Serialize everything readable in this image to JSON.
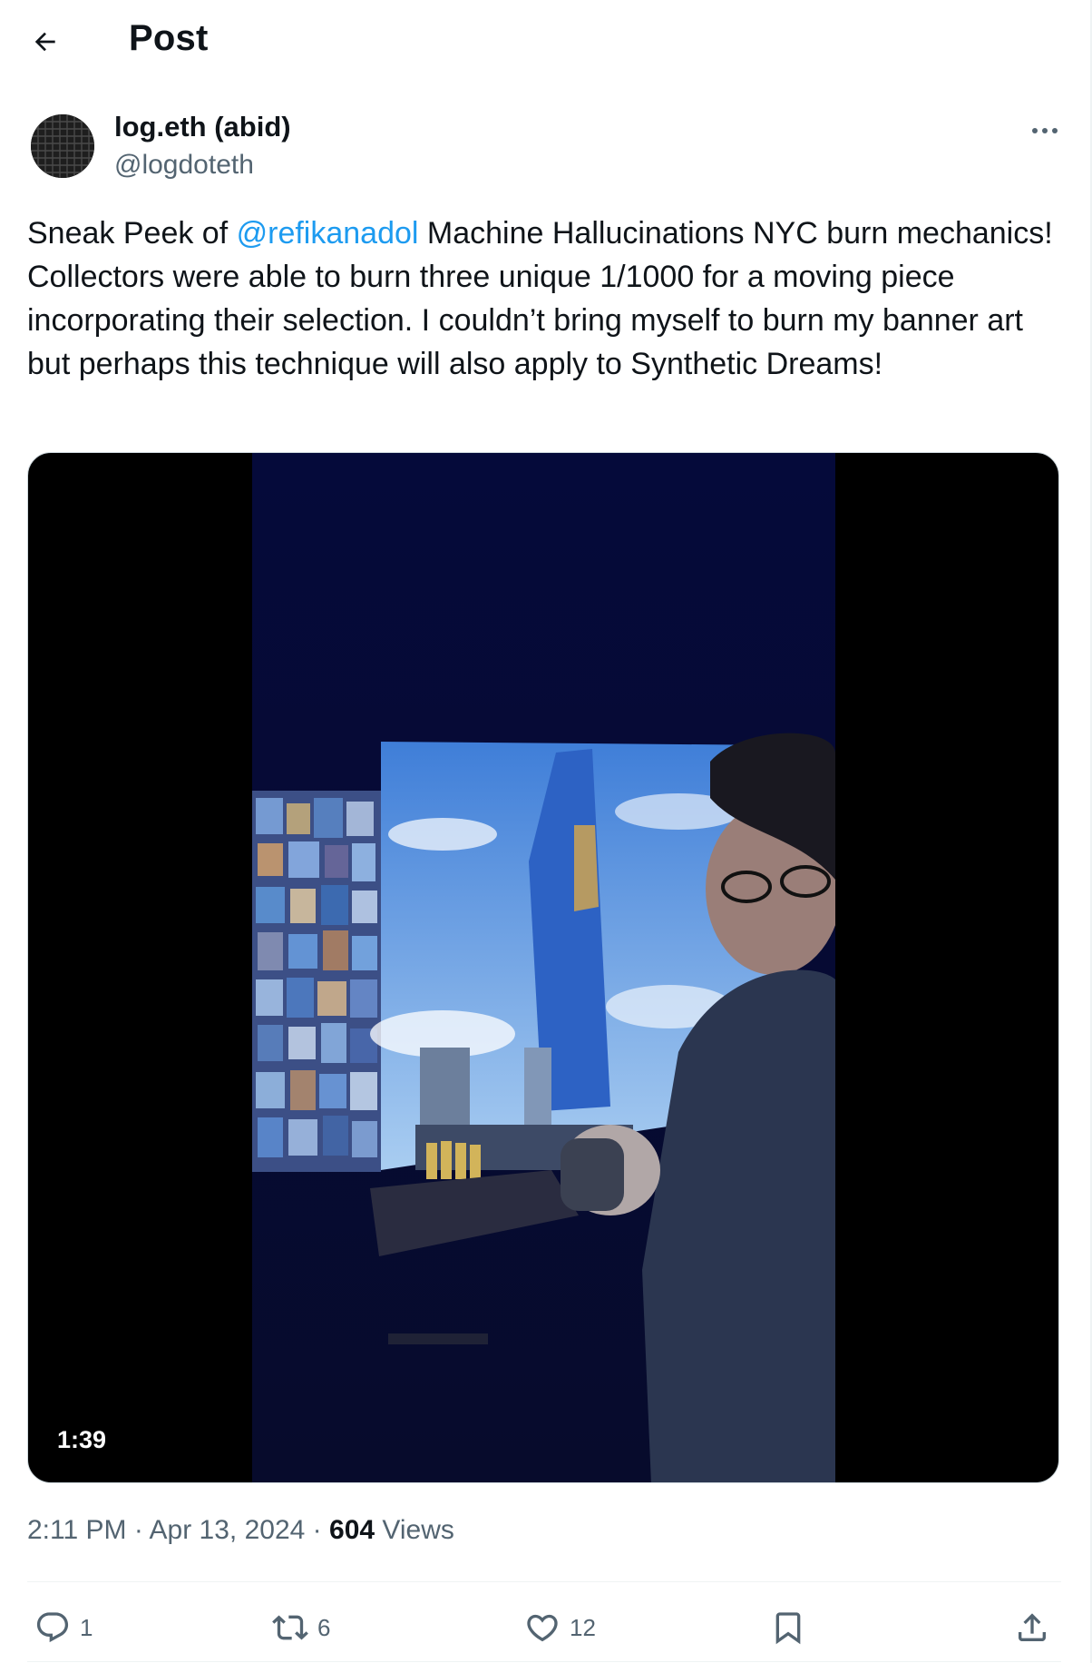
{
  "header": {
    "title": "Post",
    "back_icon": "arrow-left-icon"
  },
  "author": {
    "name": "log.eth (abid)",
    "handle": "@logdoteth",
    "more_icon": "more-horizontal-icon"
  },
  "post": {
    "text_before": "Sneak Peek of ",
    "mention": "@refikanadol",
    "text_after": " Machine Hallucinations NYC burn mechanics! Collectors were able to burn three unique 1/1000 for a moving piece incorporating their selection. I couldn’t bring myself to burn my banner art but perhaps this technique will also apply to Synthetic Dreams!"
  },
  "media": {
    "duration": "1:39"
  },
  "meta": {
    "time": "2:11 PM",
    "separator": "·",
    "date": "Apr 13, 2024",
    "views_count": "604",
    "views_label": "Views"
  },
  "actions": {
    "reply": {
      "icon": "reply-icon",
      "count": "1"
    },
    "repost": {
      "icon": "repost-icon",
      "count": "6"
    },
    "like": {
      "icon": "heart-icon",
      "count": "12"
    },
    "bookmark": {
      "icon": "bookmark-icon"
    },
    "share": {
      "icon": "share-icon"
    }
  },
  "colors": {
    "link": "#1d9bf0",
    "secondary_text": "#536471",
    "primary_text": "#0f1419"
  }
}
